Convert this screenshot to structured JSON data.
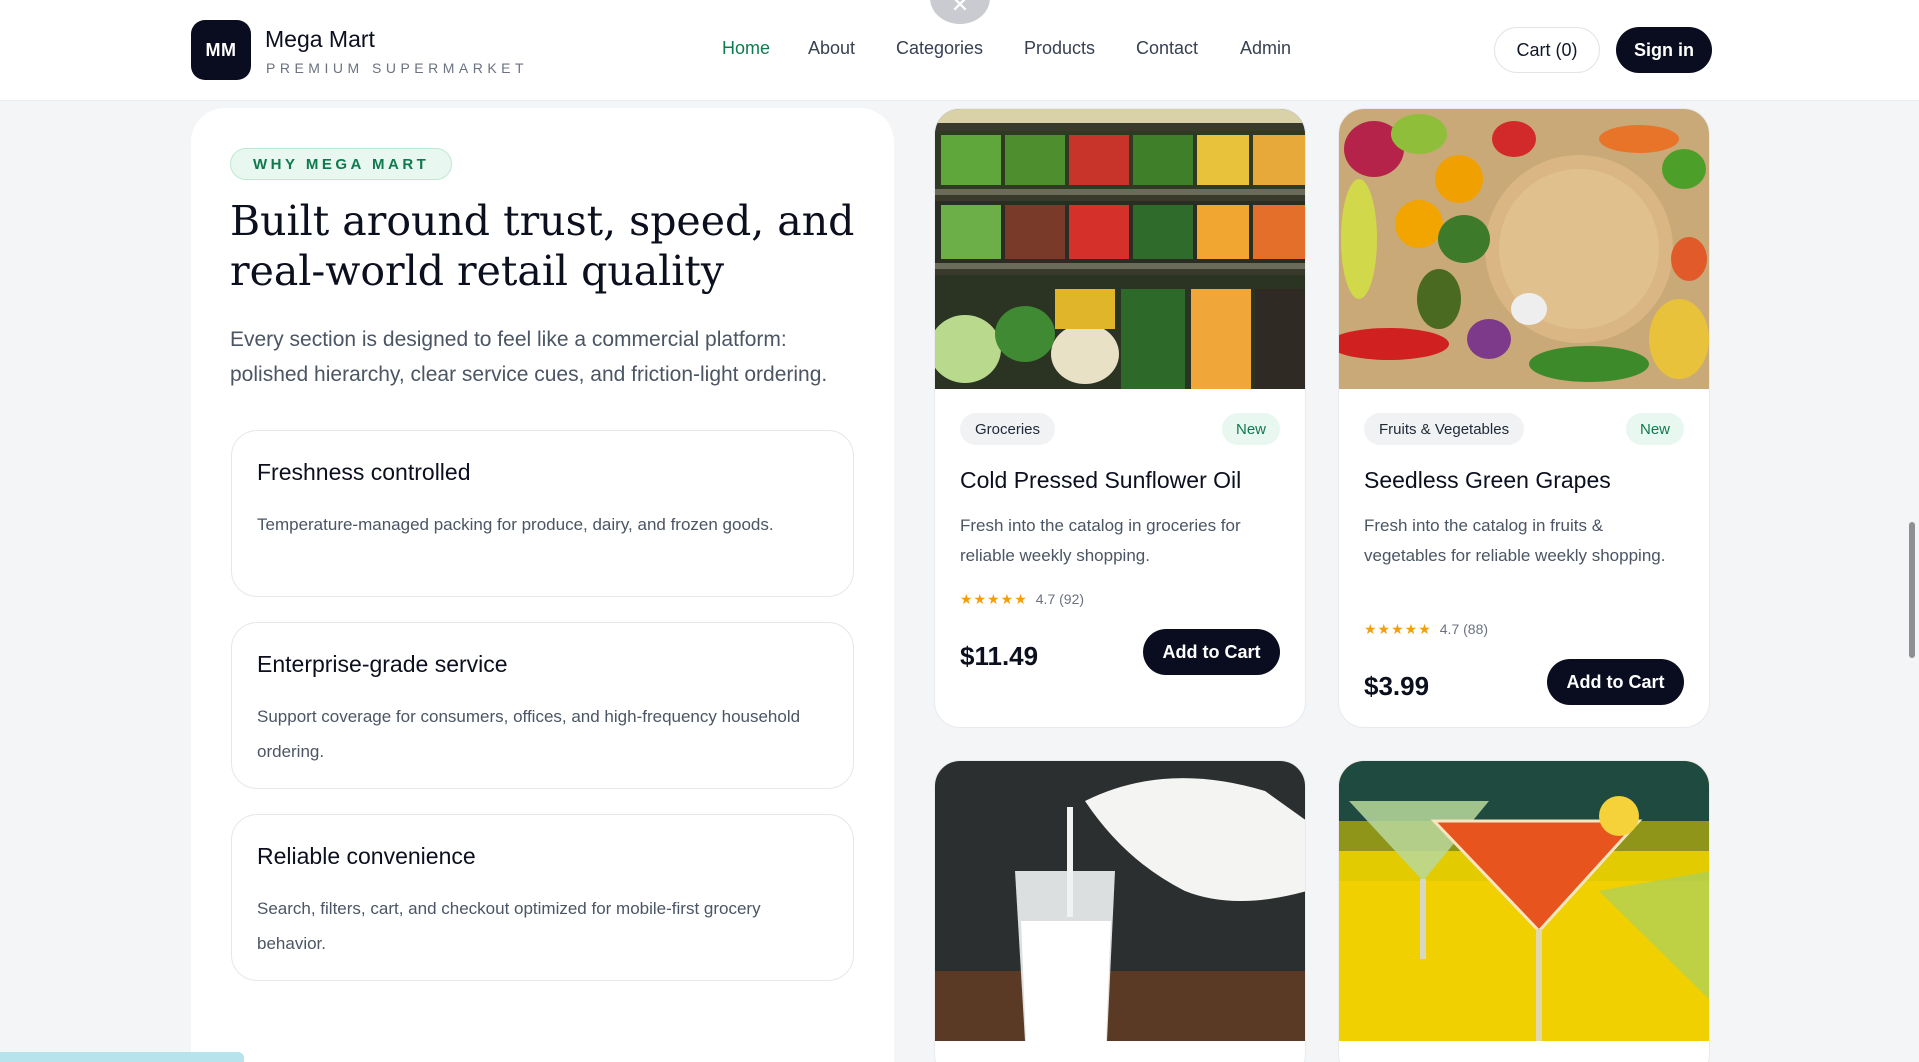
{
  "brand": {
    "logo_initials": "MM",
    "name": "Mega Mart",
    "tagline": "PREMIUM SUPERMARKET"
  },
  "nav": {
    "items": [
      {
        "label": "Home",
        "active": true
      },
      {
        "label": "About",
        "active": false
      },
      {
        "label": "Categories",
        "active": false
      },
      {
        "label": "Products",
        "active": false
      },
      {
        "label": "Contact",
        "active": false
      },
      {
        "label": "Admin",
        "active": false
      }
    ],
    "close_icon": "close-icon"
  },
  "header_actions": {
    "cart_label": "Cart (0)",
    "signin_label": "Sign in"
  },
  "why": {
    "eyebrow": "WHY MEGA MART",
    "headline": "Built around trust, speed, and real-world retail quality",
    "lead": "Every section is designed to feel like a commercial platform: polished hierarchy, clear service cues, and friction-light ordering.",
    "features": [
      {
        "title": "Freshness controlled",
        "desc": "Temperature-managed packing for produce, dairy, and frozen goods."
      },
      {
        "title": "Enterprise-grade service",
        "desc": "Support coverage for consumers, offices, and high-frequency household ordering."
      },
      {
        "title": "Reliable convenience",
        "desc": "Search, filters, cart, and checkout optimized for mobile-first grocery behavior."
      }
    ]
  },
  "products": [
    {
      "category": "Groceries",
      "badge": "New",
      "title": "Cold Pressed Sunflower Oil",
      "desc": "Fresh into the catalog in groceries for reliable weekly shopping.",
      "stars": "★★★★★",
      "rating": "4.7 (92)",
      "price": "$11.49",
      "cta": "Add to Cart",
      "image": "produce-shelves-photo"
    },
    {
      "category": "Fruits & Vegetables",
      "badge": "New",
      "title": "Seedless Green Grapes",
      "desc": "Fresh into the catalog in fruits & vegetables for reliable weekly shopping.",
      "stars": "★★★★★",
      "rating": "4.7 (88)",
      "price": "$3.99",
      "cta": "Add to Cart",
      "image": "vegetables-board-photo"
    },
    {
      "image": "milk-pour-photo"
    },
    {
      "image": "cocktails-photo"
    }
  ],
  "colors": {
    "accent_green": "#0f7a4f",
    "dark": "#0a0d1f",
    "star": "#f59e0b"
  }
}
